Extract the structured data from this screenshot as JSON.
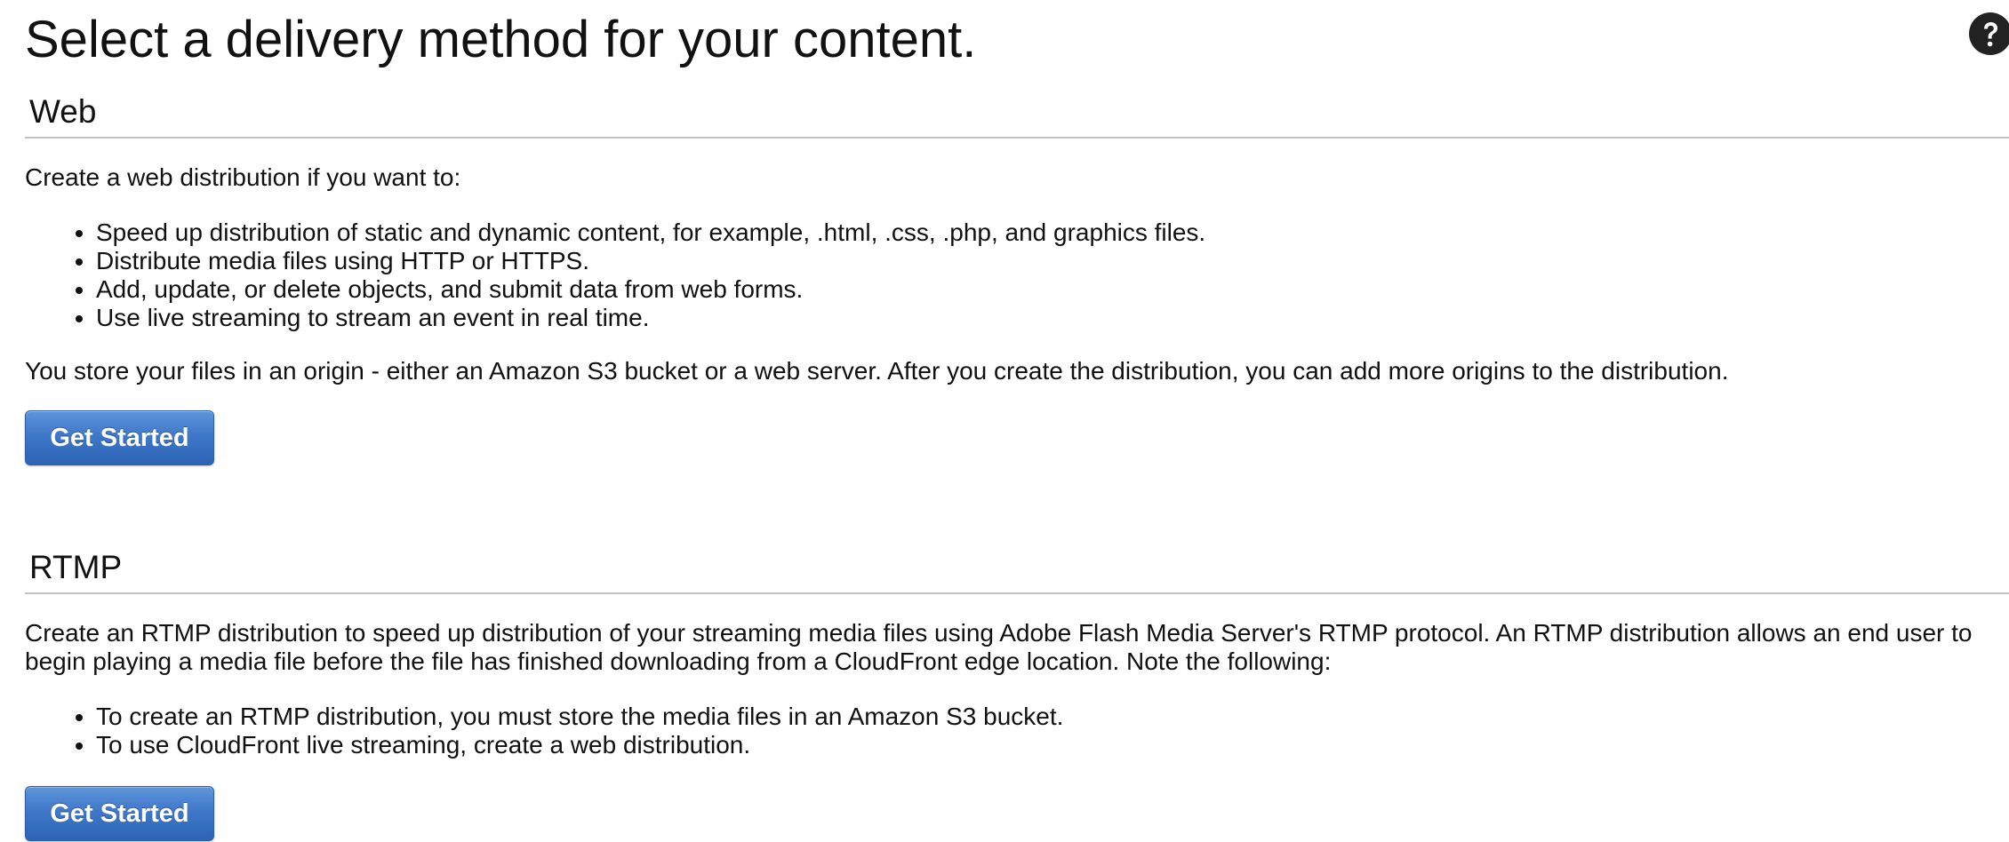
{
  "page": {
    "title": "Select a delivery method for your content.",
    "help_icon": "question-circle-icon"
  },
  "web": {
    "heading": "Web",
    "intro": "Create a web distribution if you want to:",
    "bullets": [
      "Speed up distribution of static and dynamic content, for example, .html, .css, .php, and graphics files.",
      "Distribute media files using HTTP or HTTPS.",
      "Add, update, or delete objects, and submit data from web forms.",
      "Use live streaming to stream an event in real time."
    ],
    "note": "You store your files in an origin - either an Amazon S3 bucket or a web server. After you create the distribution, you can add more origins to the distribution.",
    "button_label": "Get Started"
  },
  "rtmp": {
    "heading": "RTMP",
    "intro": "Create an RTMP distribution to speed up distribution of your streaming media files using Adobe Flash Media Server's RTMP protocol. An RTMP distribution allows an end user to begin playing a media file before the file has finished downloading from a CloudFront edge location. Note the following:",
    "bullets": [
      "To create an RTMP distribution, you must store the media files in an Amazon S3 bucket.",
      "To use CloudFront live streaming, create a web distribution."
    ],
    "button_label": "Get Started"
  },
  "colors": {
    "button_blue": "#3f78c9",
    "divider": "#c4c4c4",
    "text": "#111111",
    "icon": "#222222"
  }
}
